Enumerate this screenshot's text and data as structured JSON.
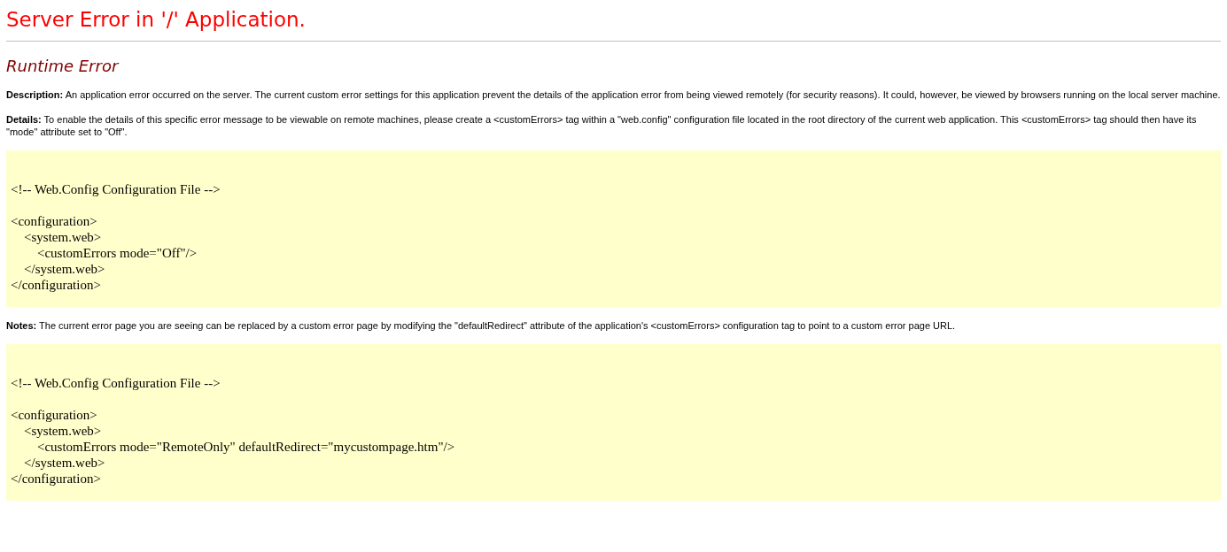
{
  "title": "Server Error in '/' Application.",
  "error_type": "Runtime Error",
  "sections": [
    {
      "text": "**Description:** An application error occurred on the server. The current custom error settings for this application prevent the details of the application error from being viewed remotely (for security reasons). It could, however, be viewed by browsers running on the local server machine."
    },
    {
      "text": "**Details:** To enable the details of this specific error message to be viewable on remote machines, please create a <customErrors> tag within a \"web.config\" configuration file located in the root directory of the current web application. This <customErrors> tag should then have its \"mode\" attribute set to \"Off\".",
      "code": "<!-- Web.Config Configuration File -->\n\n<configuration>\n    <system.web>\n        <customErrors mode=\"Off\"/>\n    </system.web>\n</configuration>"
    },
    {
      "text": "**Notes:** The current error page you are seeing can be replaced by a custom error page by modifying the \"defaultRedirect\" attribute of the application's <customErrors> configuration tag to point to a custom error page URL.",
      "code": "<!-- Web.Config Configuration File -->\n\n<configuration>\n    <system.web>\n        <customErrors mode=\"RemoteOnly\" defaultRedirect=\"mycustompage.htm\"/>\n    </system.web>\n</configuration>"
    }
  ]
}
